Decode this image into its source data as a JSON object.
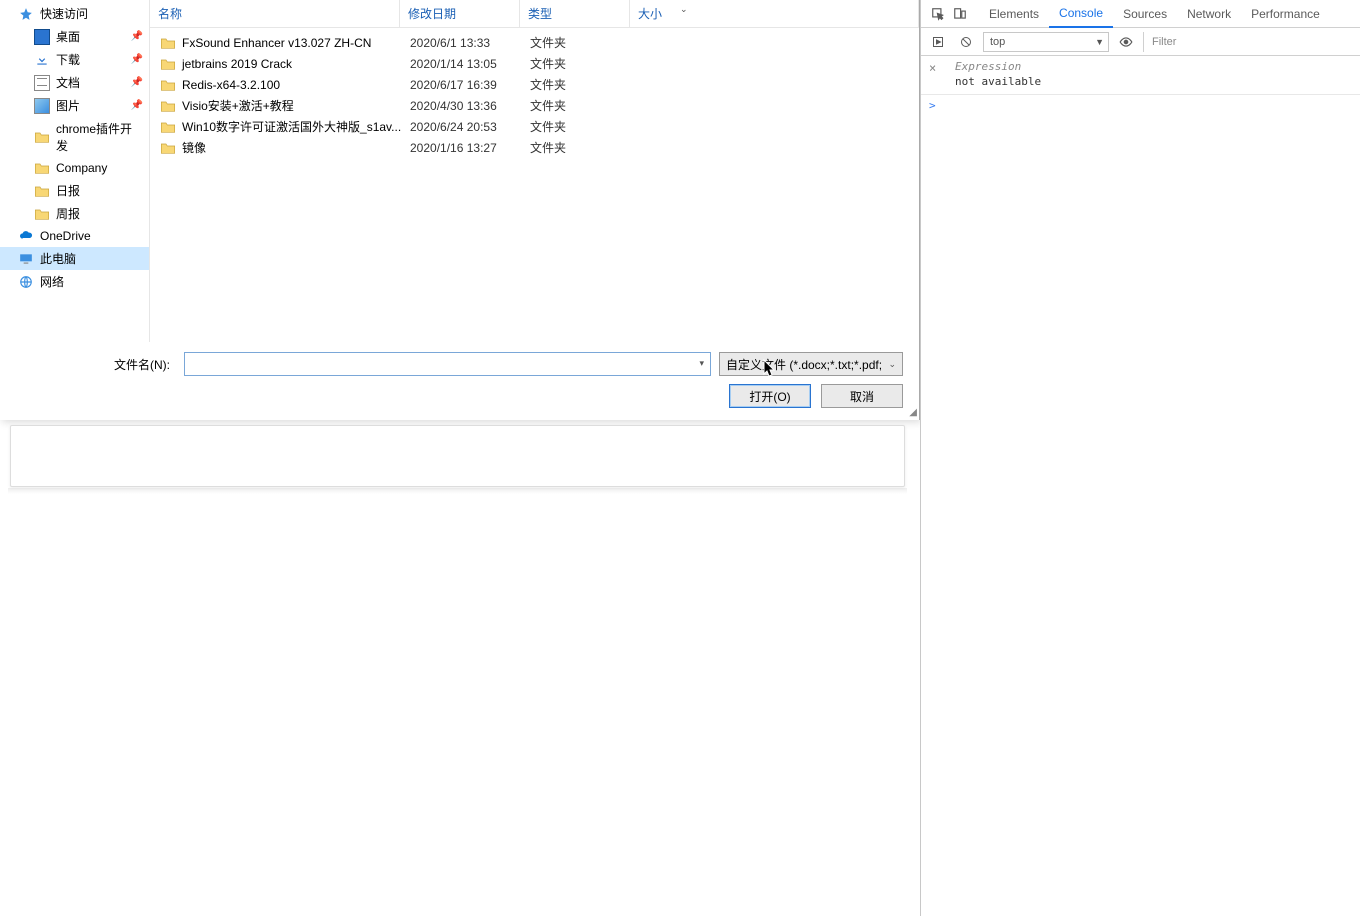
{
  "sidebar": {
    "quick_access": "快速访问",
    "desktop": "桌面",
    "downloads": "下载",
    "documents": "文档",
    "pictures": "图片",
    "chrome_dev": "chrome插件开发",
    "company": "Company",
    "daily": "日报",
    "weekly": "周报",
    "onedrive": "OneDrive",
    "this_pc": "此电脑",
    "network": "网络"
  },
  "columns": {
    "name": "名称",
    "date": "修改日期",
    "type": "类型",
    "size": "大小"
  },
  "rows": [
    {
      "name": "FxSound Enhancer v13.027 ZH-CN",
      "date": "2020/6/1 13:33",
      "type": "文件夹"
    },
    {
      "name": "jetbrains 2019 Crack",
      "date": "2020/1/14 13:05",
      "type": "文件夹"
    },
    {
      "name": "Redis-x64-3.2.100",
      "date": "2020/6/17 16:39",
      "type": "文件夹"
    },
    {
      "name": "Visio安装+激活+教程",
      "date": "2020/4/30 13:36",
      "type": "文件夹"
    },
    {
      "name": "Win10数字许可证激活国外大神版_s1av...",
      "date": "2020/6/24 20:53",
      "type": "文件夹"
    },
    {
      "name": "镜像",
      "date": "2020/1/16 13:27",
      "type": "文件夹"
    }
  ],
  "footer": {
    "filename_label": "文件名(N):",
    "filetype": "自定义文件 (*.docx;*.txt;*.pdf;",
    "open": "打开(O)",
    "cancel": "取消"
  },
  "devtools": {
    "tabs": {
      "elements": "Elements",
      "console": "Console",
      "sources": "Sources",
      "network": "Network",
      "performance": "Performance"
    },
    "context": "top",
    "filter_placeholder": "Filter",
    "watch_expr": "Expression",
    "watch_val": "not available",
    "prompt": ">"
  }
}
